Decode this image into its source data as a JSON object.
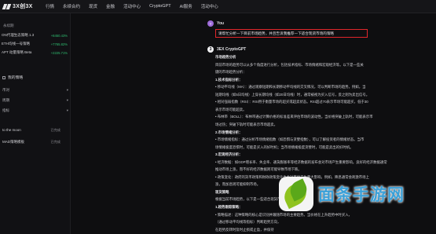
{
  "app": {
    "logo_text": "3X创3X",
    "nav": [
      "行情",
      "永续合约",
      "现货",
      "金融",
      "活动中心",
      "CryptoGPT",
      "AI服务",
      "活动中心"
    ]
  },
  "left_panel": {
    "tickers_header": "永续期",
    "tickers": [
      {
        "name": "ON代理生态策略 1.3",
        "change": "+8450.43%"
      },
      {
        "name": "ETH均线一号策略",
        "change": "+7765.82%"
      },
      {
        "name": "APT 动量策略 Beta",
        "change": "+2225.71%"
      }
    ],
    "section_title": "我的策略",
    "form_rows": [
      {
        "label": "币对",
        "icon": "chevron-down-icon"
      },
      {
        "label": "周期",
        "icon": "chevron-down-icon"
      },
      {
        "label": "指标",
        "icon": "chevron-down-icon"
      }
    ],
    "strategies": [
      {
        "name": "to the moon",
        "tag": "已完成"
      },
      {
        "name": "MAD策略模板",
        "tag": "已完成"
      }
    ]
  },
  "chat": {
    "user_name": "You",
    "user_avatar": "Y",
    "prompt": "请帮忙分析一下目前市场趋势，并且告诉我推荐一下适合现货市场的策略",
    "bot_name": "3EX CryptoGPT",
    "bot_avatar": "3",
    "answer_lines": [
      {
        "text": "市场趋势分析",
        "heading": true
      },
      {
        "text": "目前市场的趋势可以从多个角度进行分析，包括技术指标、市场情绪和宏观经济等。以下是一些关",
        "heading": false
      },
      {
        "text": "键的市场趋势分析：",
        "heading": false
      },
      {
        "text": "1.技术指标分析：",
        "heading": true
      },
      {
        "text": "• 移动平均线（MA）：通过观察短期和长期移动平均线的交叉情况，可以判断市场的趋势。例如，当",
        "heading": false
      },
      {
        "text": "短期均线（如5日均线）上穿长期均线（如20日均线）时，通常被视为买入信号，反之则为卖出信号。",
        "heading": false
      },
      {
        "text": "• 相对强弱指数（RSI）：RSI用于衡量市场的超买或超卖状态。RSI超过70表示市场可能超买，低于30",
        "heading": false
      },
      {
        "text": "表示市场可能超卖。",
        "heading": false
      },
      {
        "text": "• 布林带（BOLL）：布林带通过计算价格的标准差来评估市场的波动性。当价格突破上轨时，可能表示市",
        "heading": false
      },
      {
        "text": "场过热；突破下轨时可能表示市场超卖。",
        "heading": false
      },
      {
        "text": "2.市场情绪分析：",
        "heading": true
      },
      {
        "text": "• 市场情绪指标：通过分析市场情绪指数（如恐惧与贪婪指数），可以了解投资者的情绪状态。当市",
        "heading": false
      },
      {
        "text": "场情绪极度恐惧时，可能是买入的好时机；当市场情绪极度贪婪时，可能是卖出的好时机。",
        "heading": false
      },
      {
        "text": "3.宏观经济分析：",
        "heading": true
      },
      {
        "text": "• 经济数据：如GDP增长率、失业率、通货膨胀率等经济数据的发布会对市场产生重要影响。良好的经济数据通常",
        "heading": false
      },
      {
        "text": "推动市场上涨，而不好的经济数据则可能导致市场下跌。",
        "heading": false
      },
      {
        "text": "• 政策变化：政府的货币政策和财政政策变化也会对市场产生重大影响。例如，降息通常会刺激市场上",
        "heading": false
      },
      {
        "text": "涨，而加息则可能抑制市场。",
        "heading": false
      },
      {
        "text": "现货策略",
        "heading": true
      },
      {
        "text": "根据当前市场趋势，以下是一些适合现货市场的策略：",
        "heading": false
      },
      {
        "text": "1.趋势跟踪策略：",
        "heading": true
      },
      {
        "text": "• 策略描述：这种策略的核心是识别并跟随市场的主要趋势。当价格在上升趋势中时买入，",
        "heading": false
      },
      {
        "text": "（通过移动平均线等指标）判断趋势方向，",
        "heading": false
      },
      {
        "text": "在趋势反转时及时止损或止盈，并保持",
        "heading": false
      }
    ]
  },
  "watermark": {
    "text": "面条手游网",
    "icon": "leaf-logo-icon"
  }
}
